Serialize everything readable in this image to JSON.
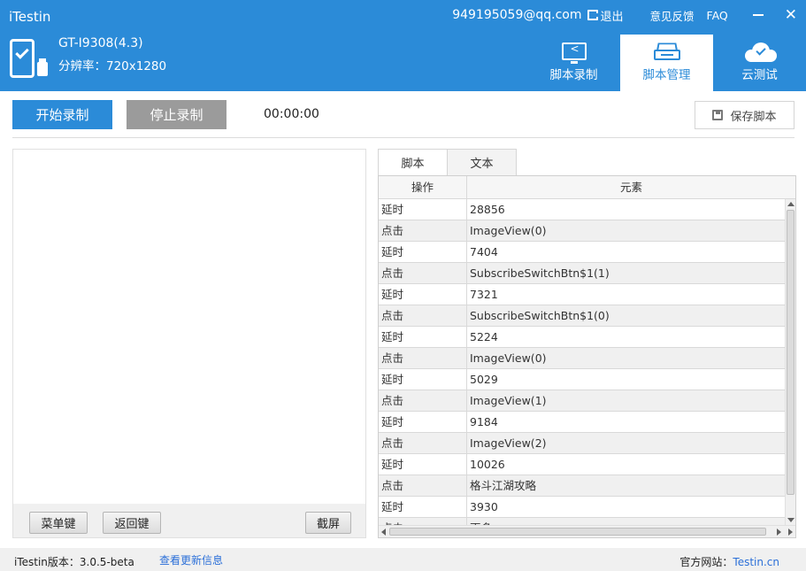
{
  "app": {
    "title": "iTestin"
  },
  "top_bar": {
    "email": "949195059@qq.com",
    "logout_label": "退出",
    "feedback_label": "意见反馈",
    "faq_label": "FAQ"
  },
  "device": {
    "model": "GT-I9308(4.3)",
    "resolution": "分辨率：720x1280",
    "icon": "phone-connected-icon"
  },
  "main_tabs": [
    {
      "label": "脚本录制",
      "icon": "screen-record-icon",
      "active": false
    },
    {
      "label": "脚本管理",
      "icon": "script-manage-icon",
      "active": true
    },
    {
      "label": "云测试",
      "icon": "cloud-test-icon",
      "active": false
    }
  ],
  "toolbar": {
    "start_label": "开始录制",
    "stop_label": "停止录制",
    "timer": "00:00:00",
    "save_label": "保存脚本"
  },
  "screen_panel": {
    "menu_key_label": "菜单键",
    "back_key_label": "返回键",
    "screenshot_label": "截屏"
  },
  "script_tabs": [
    {
      "label": "脚本",
      "active": true
    },
    {
      "label": "文本",
      "active": false
    }
  ],
  "table": {
    "columns": [
      "操作",
      "元素"
    ],
    "rows": [
      {
        "op": "延时",
        "el": "28856"
      },
      {
        "op": "点击",
        "el": "ImageView(0)"
      },
      {
        "op": "延时",
        "el": "7404"
      },
      {
        "op": "点击",
        "el": "SubscribeSwitchBtn$1(1)"
      },
      {
        "op": "延时",
        "el": "7321"
      },
      {
        "op": "点击",
        "el": "SubscribeSwitchBtn$1(0)"
      },
      {
        "op": "延时",
        "el": "5224"
      },
      {
        "op": "点击",
        "el": "ImageView(0)"
      },
      {
        "op": "延时",
        "el": "5029"
      },
      {
        "op": "点击",
        "el": "ImageView(1)"
      },
      {
        "op": "延时",
        "el": "9184"
      },
      {
        "op": "点击",
        "el": "ImageView(2)"
      },
      {
        "op": "延时",
        "el": "10026"
      },
      {
        "op": "点击",
        "el": "格斗江湖攻略"
      },
      {
        "op": "延时",
        "el": "3930"
      },
      {
        "op": "点击",
        "el": "更多"
      }
    ]
  },
  "footer": {
    "version": "iTestin版本：3.0.5-beta",
    "update_link": "查看更新信息",
    "site_label": "官方网站：",
    "site_link": "Testin.cn"
  },
  "colors": {
    "brand_blue": "#2b8bd8",
    "stop_gray": "#9b9b9b",
    "link_blue": "#2b6fd8"
  }
}
